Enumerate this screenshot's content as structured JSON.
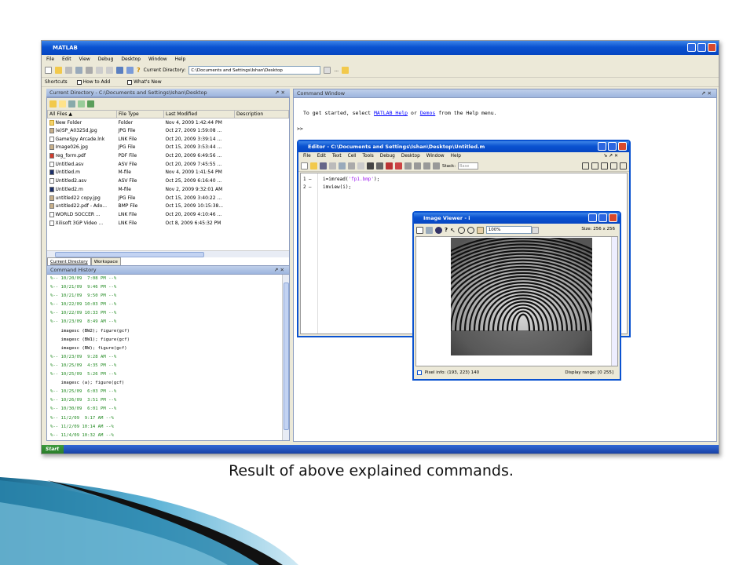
{
  "app": {
    "title": "MATLAB"
  },
  "menubar": [
    "File",
    "Edit",
    "View",
    "Debug",
    "Desktop",
    "Window",
    "Help"
  ],
  "toolbar": {
    "current_dir_label": "Current Directory:",
    "current_dir_value": "C:\\Documents and Settings\\Ishan\\Desktop",
    "help_icon": "?"
  },
  "shortcuts": {
    "label": "Shortcuts",
    "items": [
      "How to Add",
      "What's New"
    ]
  },
  "current_directory": {
    "title": "Current Directory - C:\\Documents and Settings\\Ishan\\Desktop",
    "columns": [
      "All Files ▲",
      "File Type",
      "Last Modified",
      "Description"
    ],
    "files": [
      {
        "name": "New Folder",
        "type": "Folder",
        "modified": "Nov 4, 2009 1:42:44 PM",
        "icon": "folder"
      },
      {
        "name": "(e)SP_A0325d.jpg",
        "type": "JPG File",
        "modified": "Oct 27, 2009 1:59:08 ...",
        "icon": "img"
      },
      {
        "name": "GameSpy Arcade.lnk",
        "type": "LNK File",
        "modified": "Oct 20, 2009 3:39:14 ...",
        "icon": "file"
      },
      {
        "name": "Image026.jpg",
        "type": "JPG File",
        "modified": "Oct 15, 2009 3:53:44 ...",
        "icon": "img"
      },
      {
        "name": "reg_form.pdf",
        "type": "PDF File",
        "modified": "Oct 20, 2009 6:49:56 ...",
        "icon": "pdf"
      },
      {
        "name": "Untitled.asv",
        "type": "ASV File",
        "modified": "Oct 20, 2009 7:45:55 ...",
        "icon": "file"
      },
      {
        "name": "Untitled.m",
        "type": "M-file",
        "modified": "Nov 4, 2009 1:41:54 PM",
        "icon": "m"
      },
      {
        "name": "Untitled2.asv",
        "type": "ASV File",
        "modified": "Oct 25, 2009 6:16:40 ...",
        "icon": "file"
      },
      {
        "name": "Untitled2.m",
        "type": "M-file",
        "modified": "Nov 2, 2009 9:32:01 AM",
        "icon": "m"
      },
      {
        "name": "untitled22 copy.jpg",
        "type": "JPG File",
        "modified": "Oct 15, 2009 3:40:22 ...",
        "icon": "img"
      },
      {
        "name": "untitled22.pdf - Ado...",
        "type": "BMP File",
        "modified": "Oct 15, 2009 10:15:38...",
        "icon": "img"
      },
      {
        "name": "WORLD SOCCER ...",
        "type": "LNK File",
        "modified": "Oct 20, 2009 4:10:46 ...",
        "icon": "file"
      },
      {
        "name": "Xilisoft 3GP Video ...",
        "type": "LNK File",
        "modified": "Oct 8, 2009 6:45:32 PM",
        "icon": "file"
      }
    ],
    "tabs": [
      "Current Directory",
      "Workspace"
    ]
  },
  "command_history": {
    "title": "Command History",
    "lines": [
      {
        "kind": "sess",
        "text": "%-- 10/20/09  7:08 PM --%"
      },
      {
        "kind": "sess",
        "text": "%-- 10/21/09  9:46 PM --%"
      },
      {
        "kind": "sess",
        "text": "%-- 10/21/09  9:50 PM --%"
      },
      {
        "kind": "sess",
        "text": "%-- 10/22/09 10:03 PM --%"
      },
      {
        "kind": "sess",
        "text": "%-- 10/22/09 10:33 PM --%"
      },
      {
        "kind": "sess",
        "text": "%-- 10/23/09  8:49 AM --%"
      },
      {
        "kind": "cmd",
        "text": "    imagesc (BW2); figure(gcf)"
      },
      {
        "kind": "cmd",
        "text": "    imagesc (BW1); figure(gcf)"
      },
      {
        "kind": "cmd",
        "text": "    imagesc (BW); figure(gcf)"
      },
      {
        "kind": "sess",
        "text": "%-- 10/23/09  9:28 AM --%"
      },
      {
        "kind": "sess",
        "text": "%-- 10/25/09  4:35 PM --%"
      },
      {
        "kind": "sess",
        "text": "%-- 10/25/09  5:26 PM --%"
      },
      {
        "kind": "cmd",
        "text": "    imagesc (a); figure(gcf)"
      },
      {
        "kind": "sess",
        "text": "%-- 10/25/09  6:03 PM --%"
      },
      {
        "kind": "sess",
        "text": "%-- 10/26/09  3:51 PM --%"
      },
      {
        "kind": "sess",
        "text": "%-- 10/30/09  6:01 PM --%"
      },
      {
        "kind": "sess",
        "text": "%-- 11/2/09  9:17 AM --%"
      },
      {
        "kind": "sess",
        "text": "%-- 11/2/09 10:14 AM --%"
      },
      {
        "kind": "sess",
        "text": "%-- 11/4/09 10:32 AM --%"
      },
      {
        "kind": "sess",
        "text": "%-- 11/4/09  1:36 PM --%"
      }
    ]
  },
  "command_window": {
    "title": "Command Window",
    "intro_pre": "To get started, select ",
    "link1": "MATLAB Help",
    "intro_mid": " or ",
    "link2": "Demos",
    "intro_post": " from the Help menu.",
    "prompt": ">>"
  },
  "editor": {
    "title": "Editor - C:\\Documents and Settings\\Ishan\\Desktop\\Untitled.m",
    "menus": [
      "File",
      "Edit",
      "Text",
      "Cell",
      "Tools",
      "Debug",
      "Desktop",
      "Window",
      "Help"
    ],
    "stack_label": "Stack:",
    "stack_value": "Base",
    "lines": [
      {
        "num": "1 –",
        "pre": "i=imread(",
        "str": "'fp1.bmp'",
        "post": ");"
      },
      {
        "num": "2 –",
        "pre": "imview(i);",
        "str": "",
        "post": ""
      }
    ]
  },
  "image_viewer": {
    "title": "Image Viewer - i",
    "zoom": "100%",
    "size": "Size: 256 x 256",
    "pixel_info": "Pixel info: (193, 223)  140",
    "display_range": "Display range: [0  255]"
  },
  "taskbar": {
    "start": "Start"
  },
  "caption": "Result of above explained commands."
}
